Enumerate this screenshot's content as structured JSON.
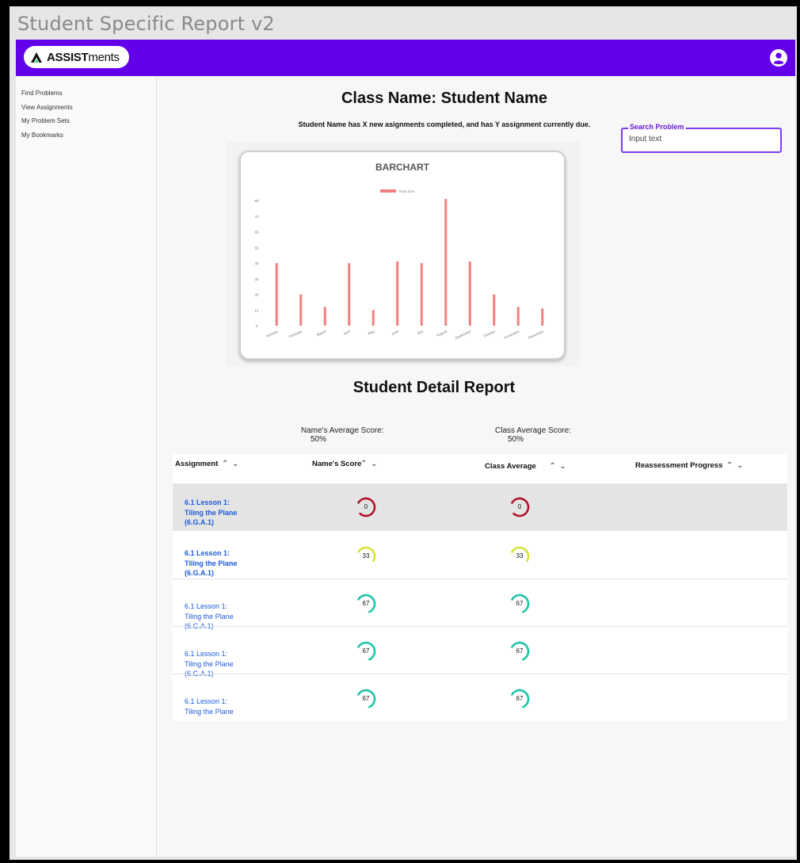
{
  "window": {
    "title": "Student Specific Report v2"
  },
  "header": {
    "logo_bold": "ASSIST",
    "logo_light": "ments",
    "brand_color": "#6200ea"
  },
  "sidebar": {
    "items": [
      {
        "label": "Find Problems"
      },
      {
        "label": "View Assignments"
      },
      {
        "label": "My Problem Sets"
      },
      {
        "label": "My Bookmarks"
      }
    ]
  },
  "main": {
    "title": "Class Name: Student Name",
    "summary": "Student Name has X new asignments completed, and has Y assignment currently due.",
    "search": {
      "label": "Search Problem",
      "value": "Input text"
    },
    "detail_title": "Student Detail Report",
    "name_avg_label": "Name's Average Score:",
    "name_avg_value": "50%",
    "class_avg_label": "Class Average Score:",
    "class_avg_value": "50%"
  },
  "chart_data": {
    "type": "bar",
    "title": "BARCHART",
    "categories": [
      "January",
      "February",
      "March",
      "April",
      "May",
      "June",
      "July",
      "August",
      "September",
      "October",
      "November",
      "December"
    ],
    "series": [
      {
        "name": "Data One",
        "values": [
          40,
          20,
          12,
          40,
          10,
          41,
          40,
          81,
          41,
          20,
          12,
          11
        ],
        "color": "#f08080"
      }
    ],
    "ylim": [
      0,
      80
    ],
    "yticks": [
      "0",
      "10",
      "20",
      "30",
      "40",
      "50",
      "60",
      "70",
      "80"
    ],
    "legend": "top",
    "grid": false
  },
  "table": {
    "headers": {
      "assignment": "Assignment",
      "name_score": "Name's Score",
      "class_avg": "Class Average",
      "reassess": "Reassessment Progress"
    },
    "rows": [
      {
        "line1": "6.1 Lesson 1:",
        "line2": "Tiling the Plane",
        "line3": "(6.G.A.1)",
        "score": "0",
        "score_color": "#b0132e",
        "score_frac": 0.78,
        "avg": "0",
        "avg_color": "#b0132e",
        "avg_frac": 0.78
      },
      {
        "line1": "6.1 Lesson 1:",
        "line2": "Tiling the Plane",
        "line3": "(6.G.A.1)",
        "score": "33",
        "score_color": "#d6e23a",
        "score_frac": 0.5,
        "avg": "33",
        "avg_color": "#d6e23a",
        "avg_frac": 0.5
      },
      {
        "line1": "6.1 Lesson 1:",
        "line2": "Tiling the Plane",
        "line3": "(6.G.A.1)",
        "score": "67",
        "score_color": "#1fc4a8",
        "score_frac": 0.6,
        "avg": "67",
        "avg_color": "#1fc4a8",
        "avg_frac": 0.6
      },
      {
        "line1": "6.1 Lesson 1:",
        "line2": "Tiling the Plane",
        "line3": "(6.G.A.1)",
        "score": "67",
        "score_color": "#1fc4a8",
        "score_frac": 0.6,
        "avg": "67",
        "avg_color": "#1fc4a8",
        "avg_frac": 0.6
      },
      {
        "line1": "6.1 Lesson 1:",
        "line2": "Tiling the Plane",
        "line3": "",
        "score": "67",
        "score_color": "#1fc4a8",
        "score_frac": 0.6,
        "avg": "67",
        "avg_color": "#1fc4a8",
        "avg_frac": 0.6
      }
    ]
  }
}
